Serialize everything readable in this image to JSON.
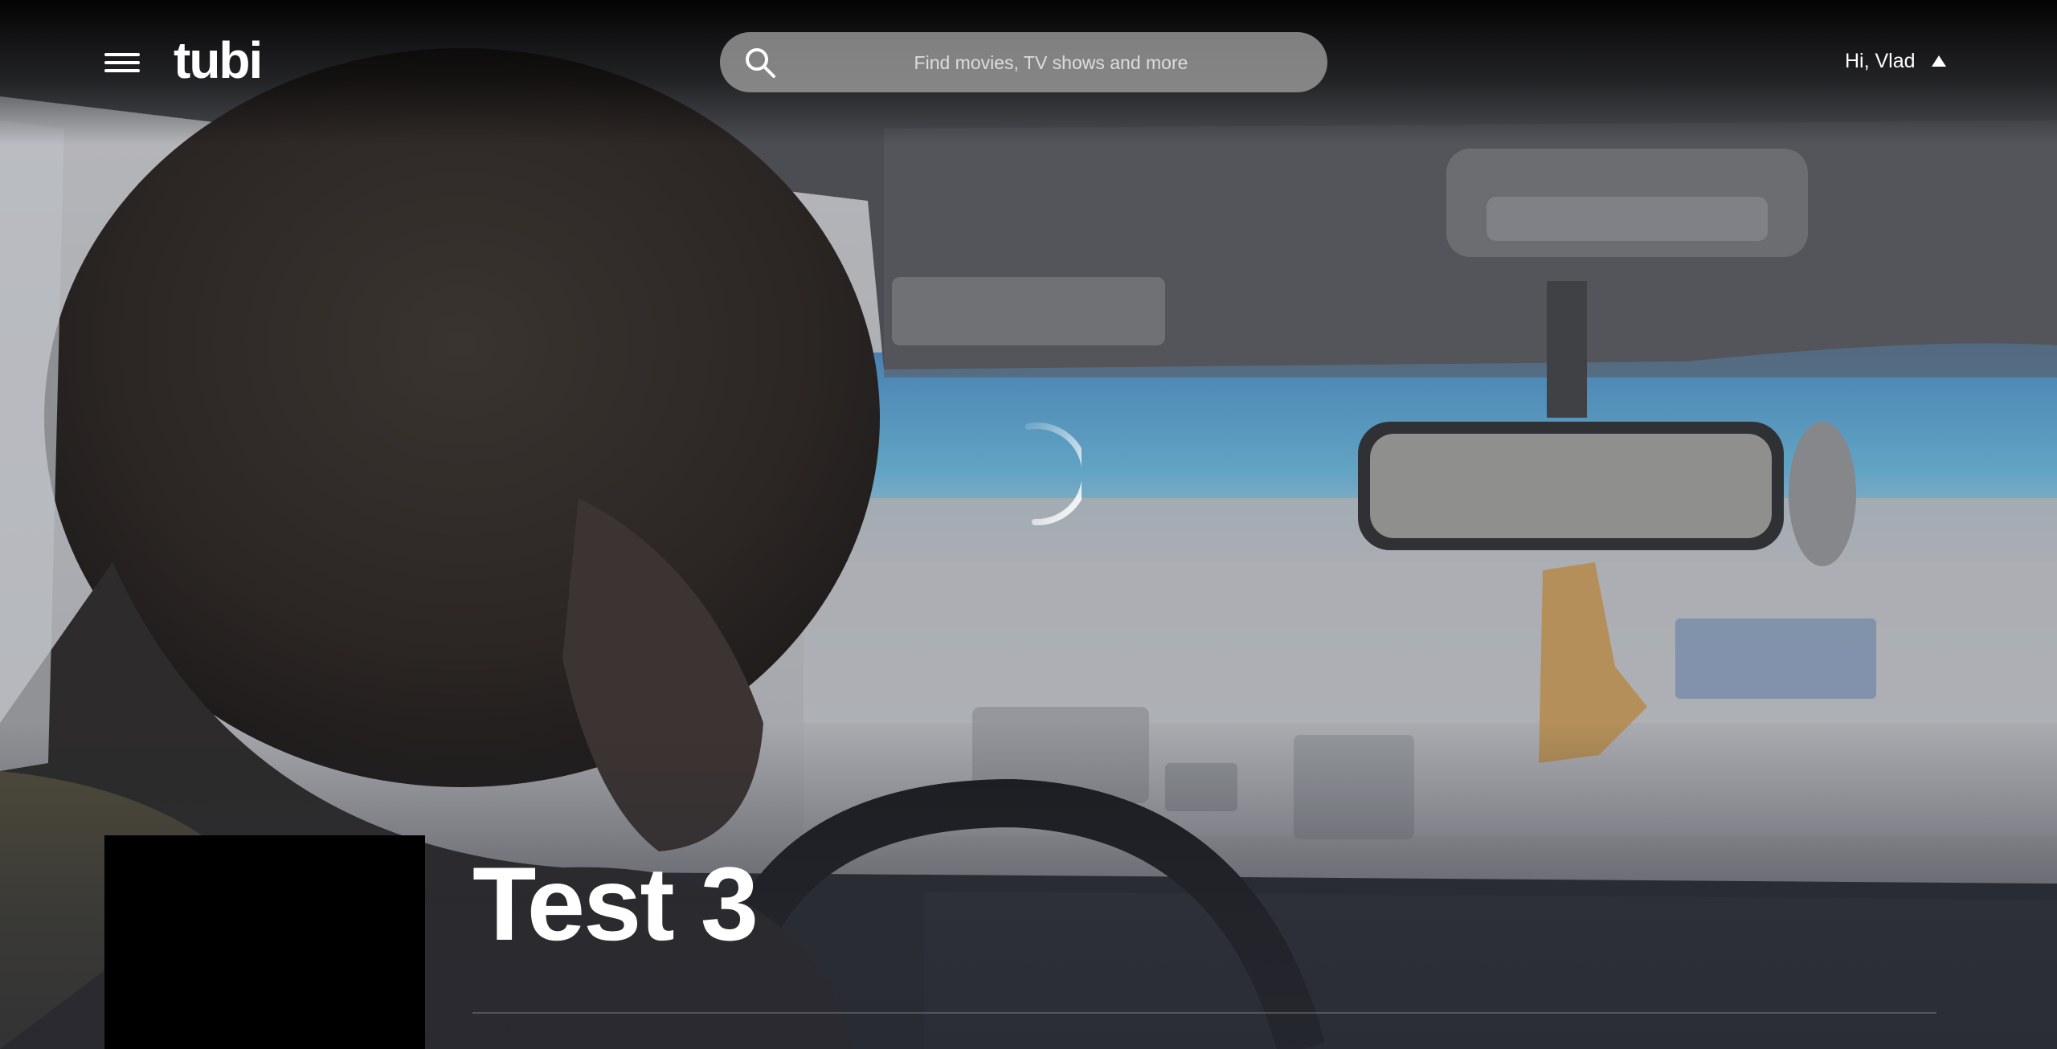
{
  "header": {
    "logo_text": "tubi",
    "search": {
      "placeholder": "Find movies, TV shows and more"
    },
    "account": {
      "greeting": "Hi, Vlad"
    }
  },
  "player": {
    "state": "loading"
  },
  "details": {
    "title": "Test 3"
  },
  "colors": {
    "background": "#3a3d44",
    "search_bg": "#a5a5a5",
    "text": "#ffffff"
  },
  "icons": {
    "menu": "hamburger-icon",
    "search": "search-icon",
    "account_caret": "caret-up-icon",
    "loading": "spinner-icon"
  }
}
